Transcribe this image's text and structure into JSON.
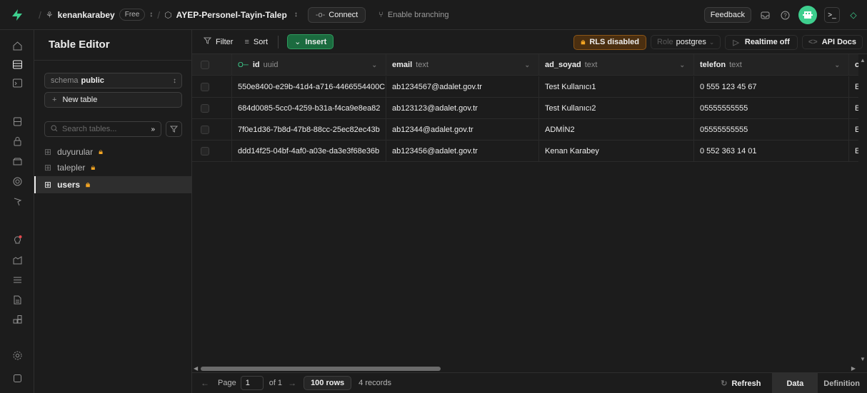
{
  "topbar": {
    "org_name": "kenankarabey",
    "plan_badge": "Free",
    "project_name": "AYEP-Personel-Tayin-Talep",
    "connect_label": "Connect",
    "enable_branching_label": "Enable branching",
    "feedback_label": "Feedback"
  },
  "sidebar": {
    "title": "Table Editor",
    "schema_prefix": "schema",
    "schema_value": "public",
    "new_table_label": "New table",
    "search_placeholder": "Search tables...",
    "tables": [
      {
        "name": "duyurular",
        "locked": true,
        "active": false
      },
      {
        "name": "talepler",
        "locked": true,
        "active": false
      },
      {
        "name": "users",
        "locked": true,
        "active": true
      }
    ]
  },
  "toolbar": {
    "filter_label": "Filter",
    "sort_label": "Sort",
    "insert_label": "Insert",
    "rls_label": "RLS disabled",
    "role_prefix": "Role",
    "role_value": "postgres",
    "realtime_label": "Realtime off",
    "api_docs_label": "API Docs"
  },
  "grid": {
    "columns": [
      {
        "name": "id",
        "type": "uuid"
      },
      {
        "name": "email",
        "type": "text"
      },
      {
        "name": "ad_soyad",
        "type": "text"
      },
      {
        "name": "telefon",
        "type": "text"
      },
      {
        "name": "c",
        "type": ""
      }
    ],
    "rows": [
      [
        "550e8400-e29b-41d4-a716-4466554400C",
        "ab1234567@adalet.gov.tr",
        "Test Kullanıcı1",
        "0 555 123 45 67",
        "E"
      ],
      [
        "684d0085-5cc0-4259-b31a-f4ca9e8ea82",
        "ab123123@adalet.gov.tr",
        "Test Kullanıcı2",
        "05555555555",
        "E"
      ],
      [
        "7f0e1d36-7b8d-47b8-88cc-25ec82ec43b",
        "ab12344@adalet.gov.tr",
        "ADMİN2",
        "05555555555",
        "E"
      ],
      [
        "ddd14f25-04bf-4af0-a03e-da3e3f68e36b",
        "ab123456@adalet.gov.tr",
        "Kenan Karabey",
        "0 552 363 14 01",
        "E"
      ]
    ]
  },
  "footer": {
    "page_label": "Page",
    "page_value": "1",
    "of_label": "of 1",
    "rows_label": "100 rows",
    "records_label": "4 records",
    "refresh_label": "Refresh",
    "data_tab": "Data",
    "definition_tab": "Definition"
  },
  "colors": {
    "accent_green": "#3ecf8e",
    "lock_amber": "#f5a623",
    "background": "#1c1c1c"
  },
  "icons": {
    "rail": [
      "home-icon",
      "table-editor-icon",
      "sql-editor-icon",
      "database-icon",
      "auth-icon",
      "storage-icon",
      "edge-functions-icon",
      "realtime-icon",
      "advisors-icon",
      "reports-icon",
      "logs-icon",
      "api-docs-icon",
      "integrations-icon",
      "settings-icon",
      "collapse-icon"
    ]
  }
}
